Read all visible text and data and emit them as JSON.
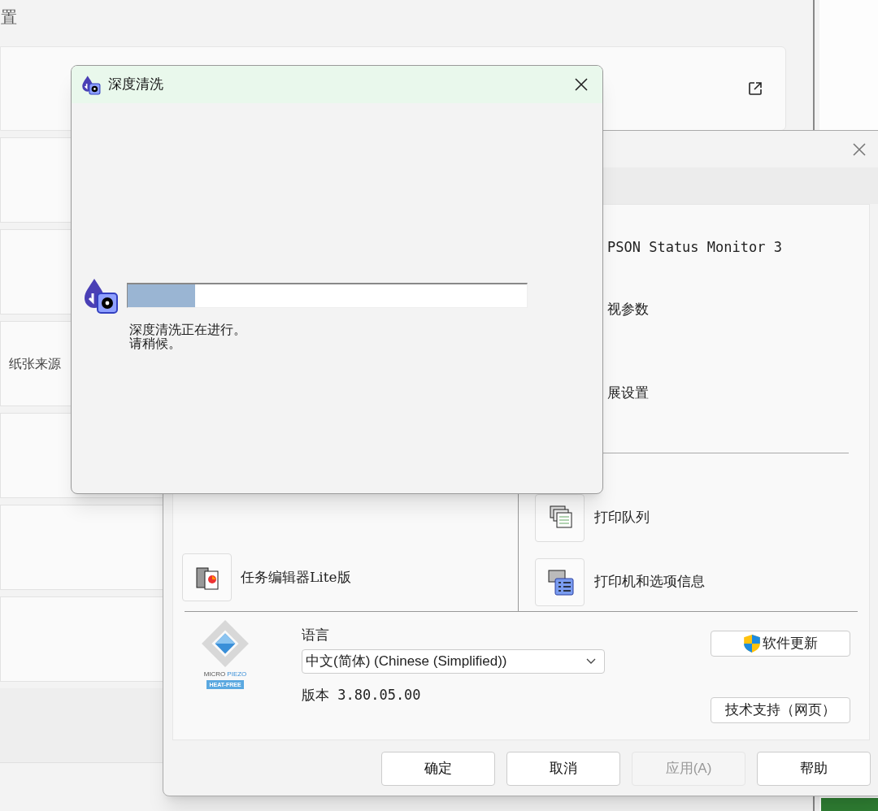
{
  "background_window": {
    "title": "置",
    "row_label": "纸张来源"
  },
  "printer_window": {
    "utilities": [
      {
        "kind": "text",
        "label": "PSON Status Monitor 3"
      },
      {
        "kind": "text",
        "label": "视参数"
      },
      {
        "kind": "text",
        "label": "展设置"
      },
      {
        "kind": "queue",
        "label": "打印队列"
      },
      {
        "kind": "info",
        "label": "打印机和选项信息"
      }
    ],
    "editor": {
      "label": "任务编辑器Lite版"
    },
    "logo": {
      "brand_left": "MICRO",
      "brand_right": "PIEZO",
      "badge": "HEAT-FREE"
    },
    "language_label": "语言",
    "language_value": "中文(简体) (Chinese (Simplified))",
    "version": "版本 3.80.05.00",
    "update_button": "软件更新",
    "support_button": "技术支持（网页）",
    "buttons": [
      {
        "label": "确定",
        "disabled": false
      },
      {
        "label": "取消",
        "disabled": false
      },
      {
        "label": "应用(A)",
        "disabled": true
      },
      {
        "label": "帮助",
        "disabled": false
      }
    ]
  },
  "cleaning_dialog": {
    "title": "深度清洗",
    "progress": {
      "level": 0.17
    },
    "message": [
      "深度清洗正在进行。",
      "请稍候。"
    ]
  }
}
